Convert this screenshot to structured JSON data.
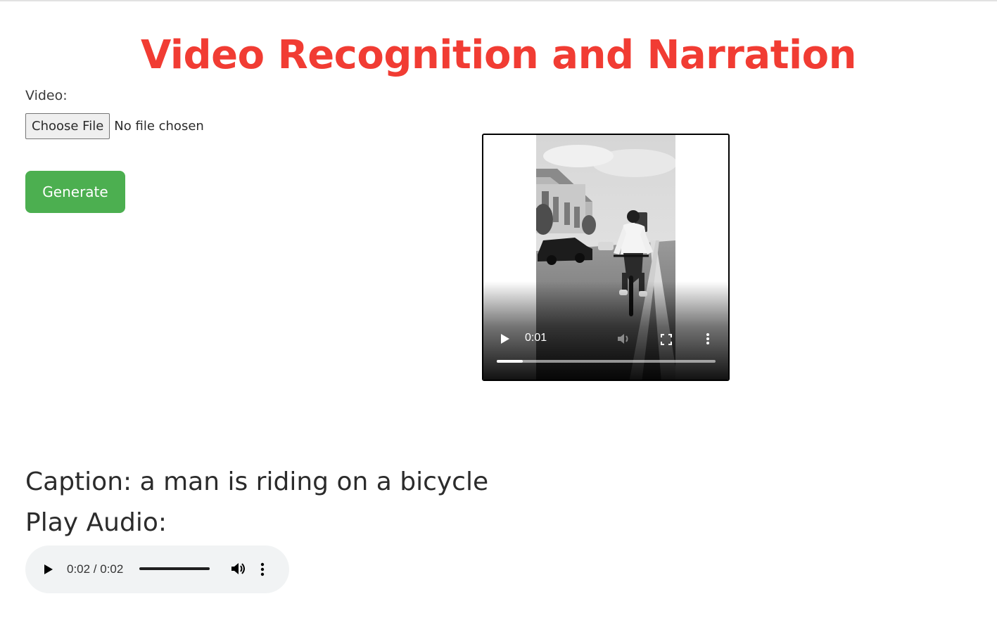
{
  "page": {
    "title": "Video Recognition and Narration",
    "title_color": "#f13c33"
  },
  "form": {
    "video_label": "Video:",
    "file_button_label": "Choose File",
    "file_status": "No file chosen",
    "generate_label": "Generate",
    "generate_color": "#4caf50"
  },
  "video_player": {
    "current_time": "0:01",
    "progress": 0.12,
    "icons": [
      "play-icon",
      "volume-icon",
      "fullscreen-icon",
      "more-options-icon"
    ]
  },
  "result": {
    "caption": "Caption: a man is riding on a bicycle",
    "play_audio_label": "Play Audio:"
  },
  "audio_player": {
    "time": "0:02 / 0:02",
    "progress": 1.0,
    "icons": [
      "play-icon",
      "volume-icon",
      "more-options-icon"
    ]
  }
}
